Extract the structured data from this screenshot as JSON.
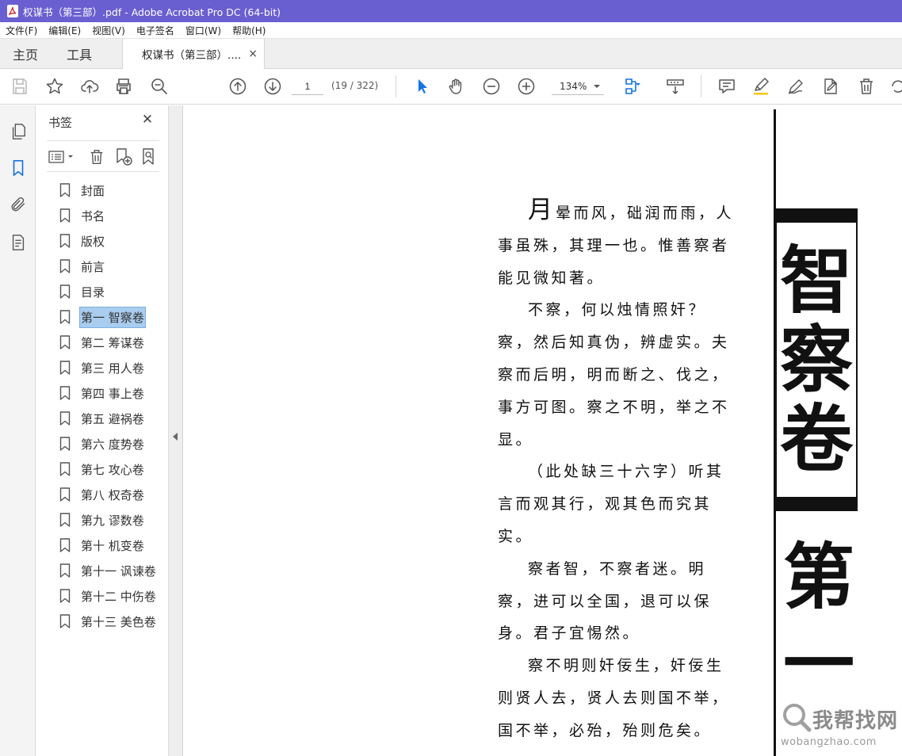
{
  "window": {
    "title": "权谋书（第三部）.pdf - Adobe Acrobat Pro DC (64-bit)"
  },
  "menu": [
    "文件(F)",
    "编辑(E)",
    "视图(V)",
    "电子签名",
    "窗口(W)",
    "帮助(H)"
  ],
  "tabs": {
    "home": "主页",
    "tools": "工具",
    "document": "权谋书（第三部）....",
    "close": "×"
  },
  "toolbar": {
    "page_value": "1",
    "page_count": "(19 / 322)",
    "zoom": "134%"
  },
  "bookmarks": {
    "header": "书签",
    "close": "✕",
    "items": [
      {
        "label": "封面",
        "selected": false
      },
      {
        "label": "书名",
        "selected": false
      },
      {
        "label": "版权",
        "selected": false
      },
      {
        "label": "前言",
        "selected": false
      },
      {
        "label": "目录",
        "selected": false
      },
      {
        "label": "第一  智察卷",
        "selected": true
      },
      {
        "label": "第二  筹谋卷",
        "selected": false
      },
      {
        "label": "第三  用人卷",
        "selected": false
      },
      {
        "label": "第四  事上卷",
        "selected": false
      },
      {
        "label": "第五  避祸卷",
        "selected": false
      },
      {
        "label": "第六  度势卷",
        "selected": false
      },
      {
        "label": "第七  攻心卷",
        "selected": false
      },
      {
        "label": "第八  权奇卷",
        "selected": false
      },
      {
        "label": "第九  谬数卷",
        "selected": false
      },
      {
        "label": "第十  机变卷",
        "selected": false
      },
      {
        "label": "第十一  讽谏卷",
        "selected": false
      },
      {
        "label": "第十二  中伤卷",
        "selected": false
      },
      {
        "label": "第十三  美色卷",
        "selected": false
      }
    ]
  },
  "document": {
    "dropcap": "月",
    "para1_rest": "晕而风，础润而雨，人事虽殊，其理一也。惟善察者能见微知著。",
    "para2": "不察，何以烛情照奸？察，然后知真伪，辨虚实。夫察而后明，明而断之、伐之，事方可图。察之不明，举之不显。",
    "para3": "（此处缺三十六字）听其言而观其行，观其色而究其实。",
    "para4": "察者智，不察者迷。明察，进可以全国，退可以保身。君子宜惕然。",
    "para5": "察不明则奸佞生，奸佞生则贤人去，贤人去则国不举，国不举，必殆，殆则危矣。",
    "vertical_title": [
      "智",
      "察",
      "卷"
    ],
    "vertical_sub": [
      "第",
      "一"
    ]
  },
  "watermark": {
    "name": "我帮找网",
    "url": "wobangzhao.com"
  },
  "colors": {
    "titlebar": "#6a5fd0",
    "accent_blue": "#1473e6",
    "selection": "#a9cdef"
  }
}
